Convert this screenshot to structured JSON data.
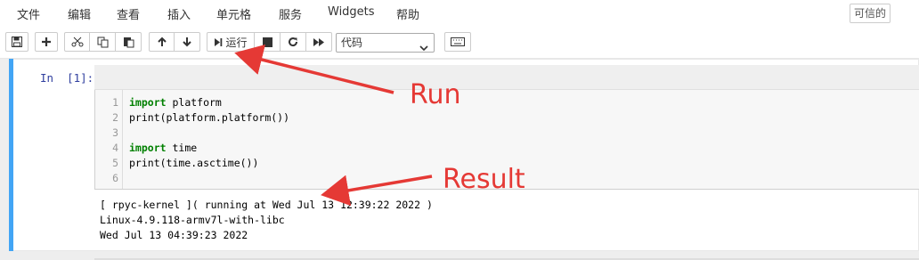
{
  "menubar": {
    "items": [
      "文件",
      "编辑",
      "查看",
      "插入",
      "单元格",
      "服务",
      "Widgets",
      "帮助"
    ],
    "trusted": "可信的"
  },
  "toolbar": {
    "run_label": "运行",
    "cell_type": "代码"
  },
  "cell": {
    "prompt": "In  [1]:",
    "line_numbers": [
      "1",
      "2",
      "3",
      "4",
      "5",
      "6"
    ],
    "code": [
      {
        "kw": "import",
        "rest": " platform"
      },
      {
        "kw": "",
        "rest": "print(platform.platform())"
      },
      {
        "kw": "",
        "rest": ""
      },
      {
        "kw": "import",
        "rest": " time"
      },
      {
        "kw": "",
        "rest": "print(time.asctime())"
      },
      {
        "kw": "",
        "rest": ""
      }
    ],
    "output": [
      "[ rpyc-kernel ]( running at Wed Jul 13 12:39:22 2022 )",
      "Linux-4.9.118-armv7l-with-libc",
      "Wed Jul 13 04:39:23 2022"
    ]
  },
  "annotations": {
    "run": "Run",
    "result": "Result",
    "color": "#e53935"
  }
}
